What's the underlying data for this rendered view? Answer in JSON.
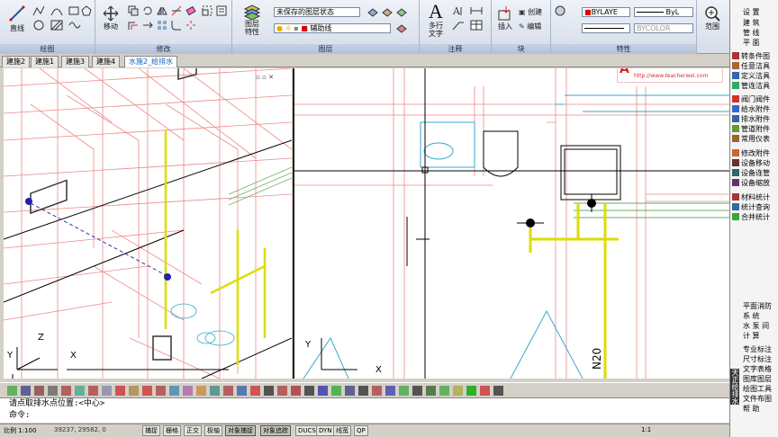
{
  "ribbon": {
    "panels": {
      "draw": "绘图",
      "modify": "修改",
      "layers": "图层",
      "annotation": "注释",
      "block": "块",
      "properties": "特性"
    },
    "buttons": {
      "line": "直线",
      "move": "移动",
      "layer_props": "图层\n特性",
      "mtext": "多行\n文字",
      "insert": "插入",
      "create": "创建",
      "edit": "编辑",
      "range": "范围"
    },
    "layer_state": "未保存的图层状态",
    "current_layer": "辅助线",
    "color": "BYLAYE",
    "linetype": "ByL",
    "bycolor": "BYCOLOR"
  },
  "tabs": [
    "建施2",
    "建施1",
    "建施3",
    "建施4",
    "水施2_给排水"
  ],
  "watermark": "http://www.teacherwei.com",
  "right_palette": {
    "top": [
      "设  置",
      "建  筑",
      "管  线",
      "平  面"
    ],
    "items": [
      "转条件图",
      "任意洁具",
      "定义洁具",
      "管连洁具",
      "阀门阀件",
      "给水附件",
      "排水附件",
      "管道附件",
      "常用仪表",
      "修改附件",
      "设备移动",
      "设备连管",
      "设备缩放",
      "材料统计",
      "统计查询",
      "合并统计"
    ],
    "bottom": [
      "平面消防",
      "系  统",
      "水 泵 间",
      "计  算",
      "专业标注",
      "尺寸标注",
      "文字表格",
      "图库图层",
      "绘图工具",
      "文件布图",
      "帮  助"
    ],
    "vertical_title": "天正给排水"
  },
  "command": {
    "line1": "请点取排水点位置:<中心>",
    "line2": "命令:"
  },
  "status": {
    "scale": "比例 1:100",
    "coords": "39237, 29582, 0",
    "buttons": [
      "捕捉",
      "栅格",
      "正交",
      "极轴",
      "对象捕捉",
      "对象追踪",
      "DUCS",
      "DYN",
      "线宽",
      "QP"
    ],
    "on_buttons": [
      "对象捕捉",
      "对象追踪"
    ],
    "annotation_scale": "1:1"
  },
  "viewport_left": {
    "ucs_labels": [
      "Y",
      "Z",
      "X"
    ]
  },
  "viewport_right": {
    "ucs_labels": [
      "Y",
      "X"
    ],
    "pipe_label": "N20"
  }
}
